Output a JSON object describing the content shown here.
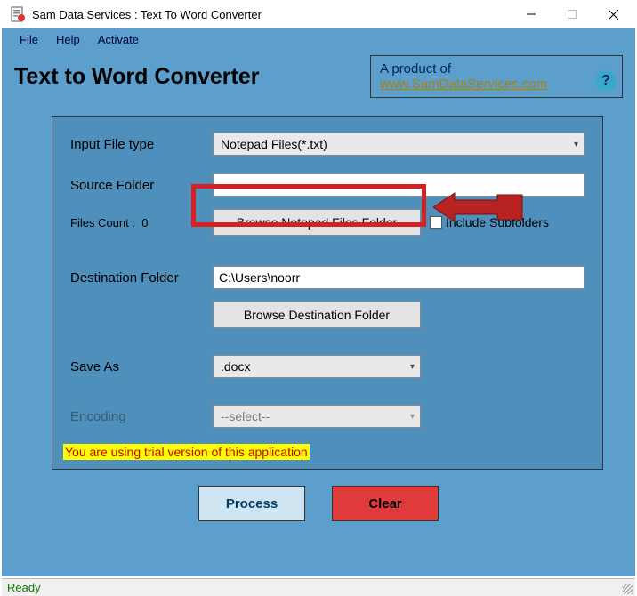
{
  "window": {
    "title": "Sam Data Services : Text To Word Converter"
  },
  "menubar": {
    "file": "File",
    "help": "Help",
    "activate": "Activate"
  },
  "header": {
    "app_title": "Text to Word Converter",
    "product_label": "A product of",
    "product_link": "www.SamDataServices.com",
    "help_glyph": "?"
  },
  "form": {
    "input_file_type_label": "Input File type",
    "input_file_type_value": "Notepad Files(*.txt)",
    "source_folder_label": "Source Folder",
    "source_folder_value": "",
    "files_count_label": "Files Count :",
    "files_count_value": "0",
    "browse_source_label": "Browse Notepad Files Folder",
    "include_subfolders_label": "Include Subfolders",
    "destination_folder_label": "Destination Folder",
    "destination_folder_value": "C:\\Users\\noorr",
    "browse_dest_label": "Browse Destination Folder",
    "save_as_label": "Save As",
    "save_as_value": ".docx",
    "encoding_label": "Encoding",
    "encoding_value": "--select--",
    "trial_message": "You are using trial version of this application"
  },
  "actions": {
    "process": "Process",
    "clear": "Clear"
  },
  "status": {
    "text": "Ready"
  }
}
